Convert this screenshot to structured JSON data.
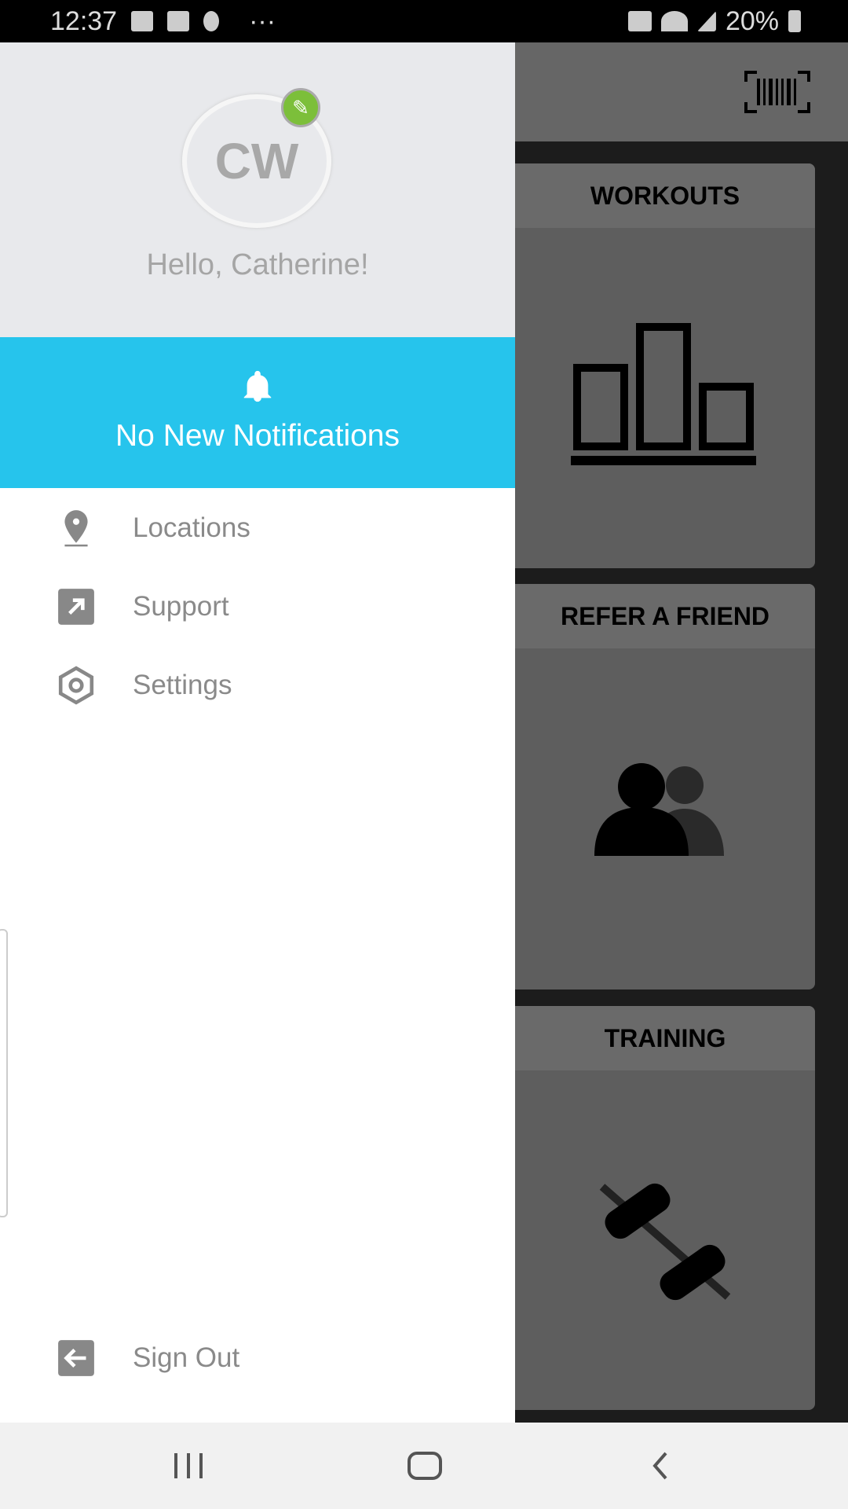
{
  "status_bar": {
    "time": "12:37",
    "battery": "20%",
    "icons": [
      "image-icon",
      "gmail-icon",
      "accessibility-icon",
      "more-icon",
      "mute-icon",
      "wifi-icon",
      "signal-icon",
      "battery-charging-icon"
    ],
    "more": "···"
  },
  "drawer": {
    "avatar_initials": "CW",
    "greeting": "Hello, Catherine!",
    "notifications": "No New Notifications",
    "items": [
      {
        "label": "Locations",
        "icon": "location-pin-icon"
      },
      {
        "label": "Support",
        "icon": "external-link-icon"
      },
      {
        "label": "Settings",
        "icon": "settings-hex-icon"
      }
    ],
    "sign_out": "Sign Out",
    "accent": "#26c4ec"
  },
  "background": {
    "cards": [
      {
        "title": "WORKOUTS",
        "icon": "bar-chart-icon"
      },
      {
        "title": "REFER A FRIEND",
        "icon": "people-icon"
      },
      {
        "title": "TRAINING",
        "icon": "dumbbell-icon"
      }
    ]
  }
}
